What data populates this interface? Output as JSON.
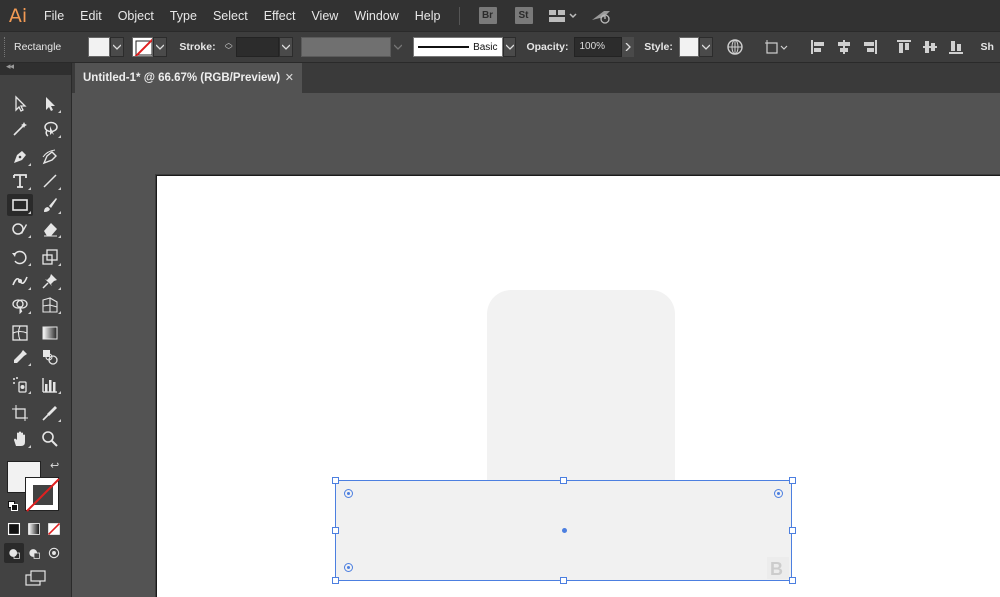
{
  "app": {
    "logo": "Ai",
    "menus": [
      "File",
      "Edit",
      "Object",
      "Type",
      "Select",
      "Effect",
      "View",
      "Window",
      "Help"
    ],
    "bridge_badge": "Br",
    "stock_badge": "St"
  },
  "control_bar": {
    "tool_name": "Rectangle",
    "stroke_label": "Stroke:",
    "brush_label": "Basic",
    "opacity_label": "Opacity:",
    "opacity_value": "100%",
    "style_label": "Style:",
    "overflow_label": "Sh"
  },
  "document": {
    "tab_title": "Untitled-1* @ 66.67% (RGB/Preview)",
    "close_glyph": "✕"
  },
  "toolbar": {
    "collapse_glyph": "◂◂",
    "swap_glyph": "↩"
  },
  "colors": {
    "accent": "#4c7fe0",
    "logo": "#f29a54",
    "fill": "#f2f2f2"
  }
}
